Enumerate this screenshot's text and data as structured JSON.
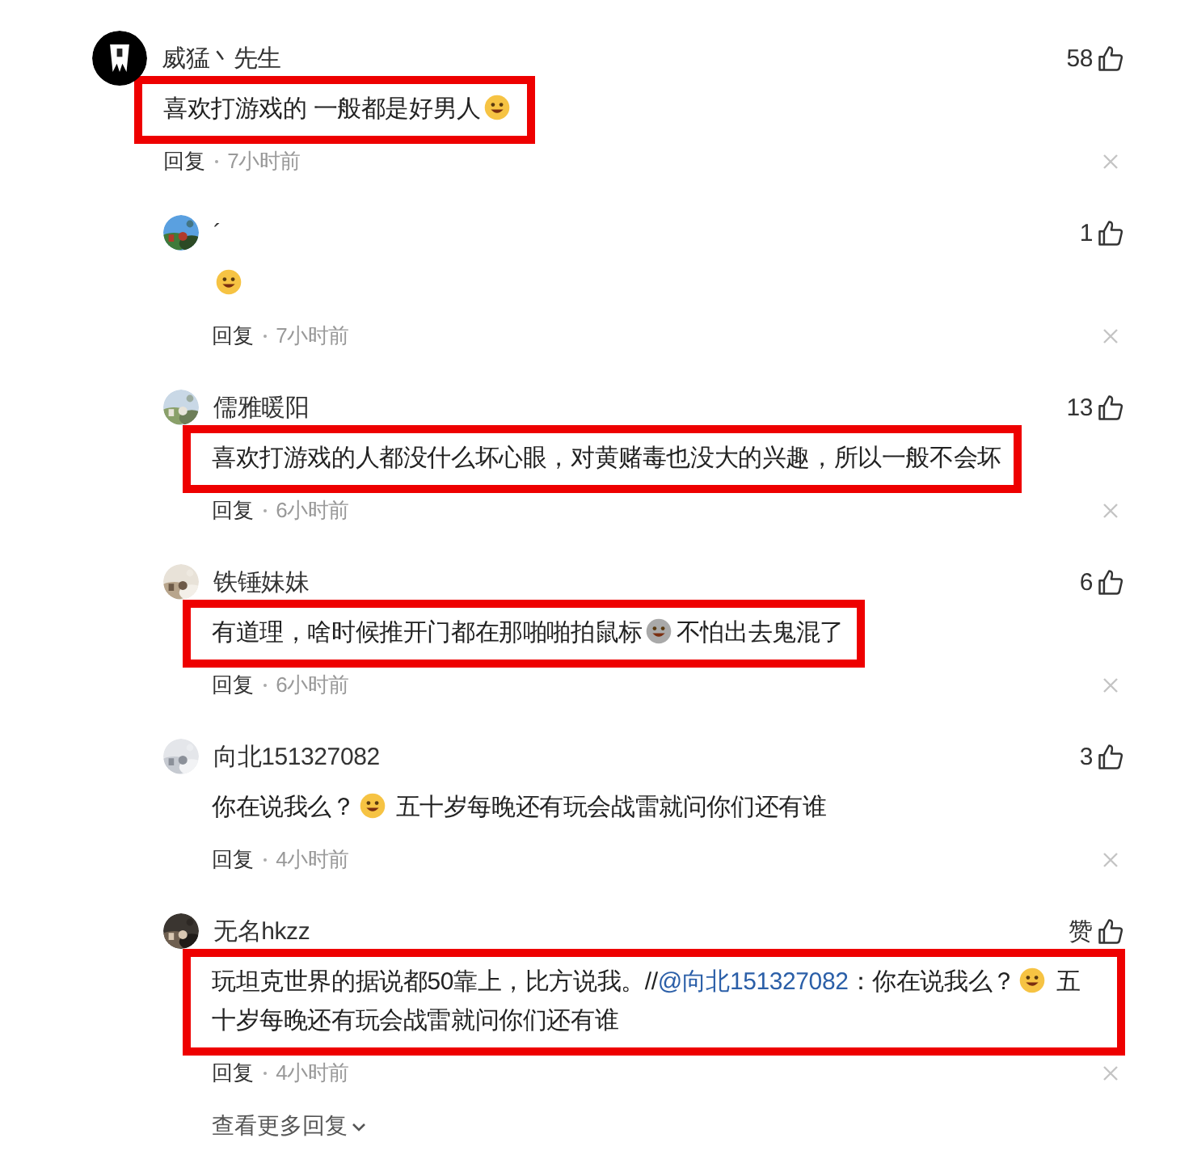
{
  "comment": {
    "author": "威猛丶先生",
    "likes": "58",
    "highlighted": true,
    "content": [
      {
        "kind": "text",
        "text": "喜欢打游戏的 一般都是好男人"
      },
      {
        "kind": "emoji",
        "color": "#f6c343"
      }
    ],
    "reply_label": "回复",
    "time": "7小时前"
  },
  "replies": [
    {
      "author": "´",
      "likes": "1",
      "highlighted": false,
      "content": [
        {
          "kind": "emoji",
          "color": "#f6c343"
        }
      ],
      "reply_label": "回复",
      "time": "7小时前"
    },
    {
      "author": "儒雅暖阳",
      "likes": "13",
      "highlighted": true,
      "content": [
        {
          "kind": "text",
          "text": "喜欢打游戏的人都没什么坏心眼，对黄赌毒也没大的兴趣，所以一般不会坏"
        }
      ],
      "reply_label": "回复",
      "time": "6小时前"
    },
    {
      "author": "铁锤妹妹",
      "likes": "6",
      "highlighted": true,
      "content": [
        {
          "kind": "text",
          "text": "有道理，啥时候推开门都在那啪啪拍鼠标"
        },
        {
          "kind": "emoji",
          "color": "#a9a9a9"
        },
        {
          "kind": "text",
          "text": "不怕出去鬼混了"
        }
      ],
      "reply_label": "回复",
      "time": "6小时前"
    },
    {
      "author": "向北151327082",
      "likes": "3",
      "highlighted": false,
      "content": [
        {
          "kind": "text",
          "text": "你在说我么？"
        },
        {
          "kind": "emoji",
          "color": "#f6c343"
        },
        {
          "kind": "text",
          "text": " 五十岁每晚还有玩会战雷就问你们还有谁"
        }
      ],
      "reply_label": "回复",
      "time": "4小时前"
    },
    {
      "author": "无名hkzz",
      "likes": "赞",
      "highlighted": true,
      "content": [
        {
          "kind": "text",
          "text": "玩坦克世界的据说都50靠上，比方说我。//"
        },
        {
          "kind": "mention",
          "text": "@向北151327082"
        },
        {
          "kind": "text",
          "text": "：你在说我么？"
        },
        {
          "kind": "emoji",
          "color": "#f6c343"
        },
        {
          "kind": "text",
          "text": " 五"
        },
        {
          "kind": "text",
          "text": "十岁每晚还有玩会战雷就问你们还有谁"
        }
      ],
      "reply_label": "回复",
      "time": "4小时前"
    }
  ],
  "more_replies": "查看更多回复"
}
